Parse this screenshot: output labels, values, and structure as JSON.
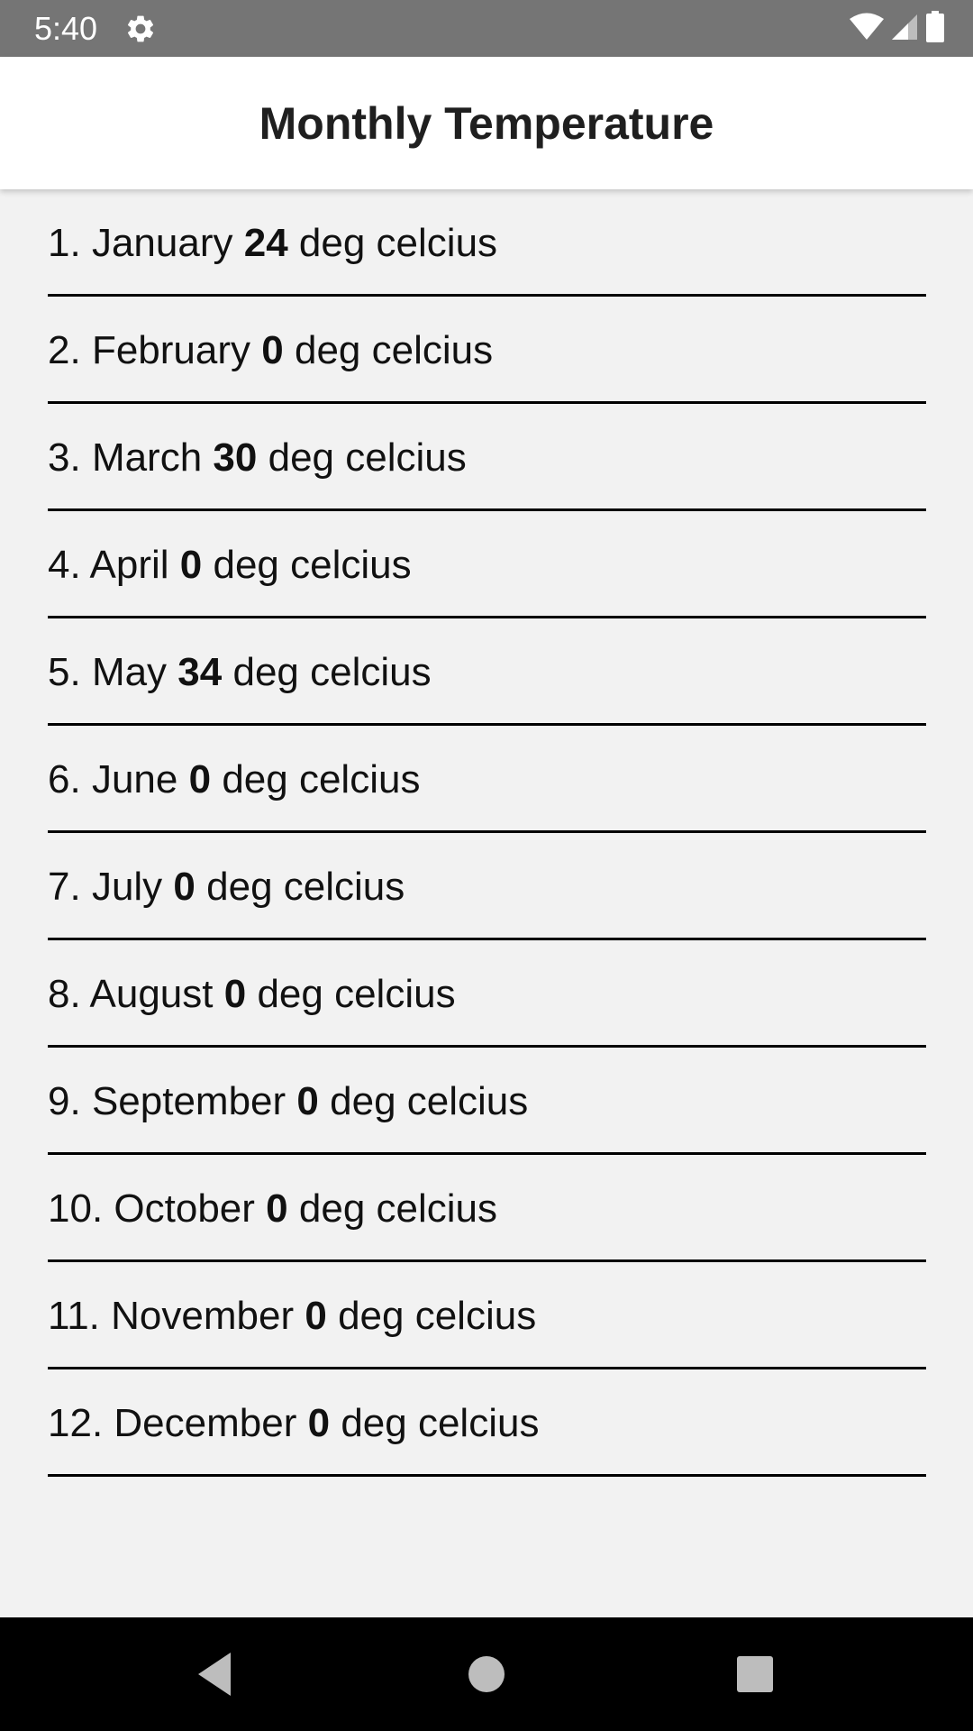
{
  "status_bar": {
    "time": "5:40",
    "icons": [
      "settings-icon",
      "wifi-icon",
      "cellular-signal-icon",
      "battery-icon"
    ]
  },
  "app_bar": {
    "title": "Monthly Temperature"
  },
  "months": [
    {
      "index": "1.",
      "name": "January",
      "value": "24",
      "unit": "deg celcius"
    },
    {
      "index": "2.",
      "name": "February",
      "value": "0",
      "unit": "deg celcius"
    },
    {
      "index": "3.",
      "name": "March",
      "value": "30",
      "unit": "deg celcius"
    },
    {
      "index": "4.",
      "name": "April",
      "value": "0",
      "unit": "deg celcius"
    },
    {
      "index": "5.",
      "name": "May",
      "value": "34",
      "unit": "deg celcius"
    },
    {
      "index": "6.",
      "name": "June",
      "value": "0",
      "unit": "deg celcius"
    },
    {
      "index": "7.",
      "name": "July",
      "value": "0",
      "unit": "deg celcius"
    },
    {
      "index": "8.",
      "name": "August",
      "value": "0",
      "unit": "deg celcius"
    },
    {
      "index": "9.",
      "name": "September",
      "value": "0",
      "unit": "deg celcius"
    },
    {
      "index": "10.",
      "name": "October",
      "value": "0",
      "unit": "deg celcius"
    },
    {
      "index": "11.",
      "name": "November",
      "value": "0",
      "unit": "deg celcius"
    },
    {
      "index": "12.",
      "name": "December",
      "value": "0",
      "unit": "deg celcius"
    }
  ],
  "nav_bar": {
    "buttons": [
      "back-icon",
      "home-icon",
      "recents-icon"
    ]
  },
  "colors": {
    "status_bar": "#757575",
    "app_bar": "#ffffff",
    "background": "#f2f2f2",
    "divider": "#000000",
    "nav_bar": "#000000"
  }
}
